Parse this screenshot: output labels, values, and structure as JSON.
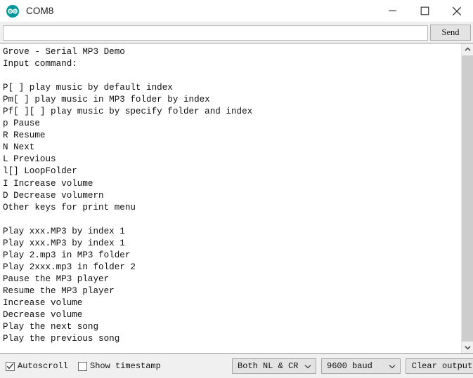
{
  "window": {
    "title": "COM8",
    "icon": "arduino-logo-icon",
    "accent_color": "#00979c",
    "controls": {
      "minimize": "minimize-icon",
      "maximize": "maximize-icon",
      "close": "close-icon"
    }
  },
  "toolbar": {
    "input_value": "",
    "input_placeholder": "",
    "send_label": "Send"
  },
  "console": {
    "lines": [
      "Grove - Serial MP3 Demo",
      "Input command:",
      "",
      "P[ ] play music by default index",
      "Pm[ ] play music in MP3 folder by index",
      "Pf[ ][ ] play music by specify folder and index",
      "p Pause",
      "R Resume",
      "N Next",
      "L Previous",
      "l[] LoopFolder",
      "I Increase volume",
      "D Decrease volumern",
      "Other keys for print menu",
      "",
      "Play xxx.MP3 by index 1",
      "Play xxx.MP3 by index 1",
      "Play 2.mp3 in MP3 folder",
      "Play 2xxx.mp3 in folder 2",
      "Pause the MP3 player",
      "Resume the MP3 player",
      "Increase volume",
      "Decrease volume",
      "Play the next song",
      "Play the previous song"
    ]
  },
  "scrollbar": {
    "up_arrow": "chevron-up-icon",
    "down_arrow": "chevron-down-icon"
  },
  "statusbar": {
    "autoscroll_label": "Autoscroll",
    "autoscroll_checked": true,
    "timestamp_label": "Show timestamp",
    "timestamp_checked": false,
    "line_ending_value": "Both NL & CR",
    "baud_value": "9600 baud",
    "clear_label": "Clear output"
  }
}
